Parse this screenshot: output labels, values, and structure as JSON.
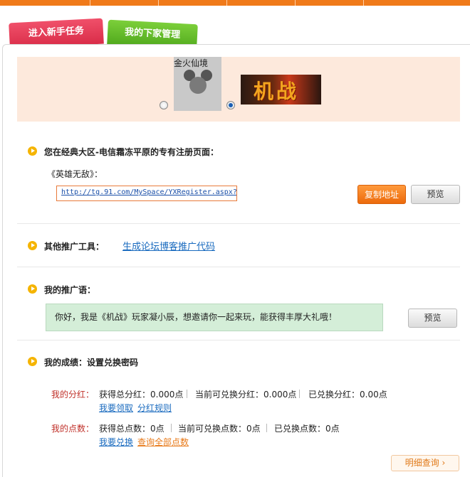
{
  "tabs": {
    "new_task": "进入新手任务",
    "my_downline": "我的下家管理"
  },
  "banner": {
    "logo_caption": "金火仙境",
    "game_logo_text": "机战"
  },
  "register": {
    "heading": "您在经典大区-电信霜冻平原的专有注册页面：",
    "game_name": "《英雄无敌》：",
    "url": "http://tg.91.com/MySpace/YXRegister.aspx?",
    "copy_button": "复制地址",
    "preview_button": "预览"
  },
  "tools": {
    "heading": "其他推广工具：",
    "link": "生成论坛博客推广代码"
  },
  "slogan": {
    "heading": "我的推广语：",
    "message": "你好，我是《机战》玩家凝小辰，想邀请你一起来玩，能获得丰厚大礼哦！",
    "preview_button": "预览"
  },
  "results": {
    "heading": "我的成绩：设置兑换密码",
    "dividend": {
      "label": "我的分红：",
      "total": "获得总分红：0.000点",
      "available": "当前可兑换分红：0.000点",
      "redeemed": "已兑换分红：0.00点",
      "link1": "我要领取",
      "link2": "分红规则"
    },
    "points": {
      "label": "我的点数：",
      "total": "获得总点数：0点",
      "available": "当前可兑换点数：0点",
      "redeemed": "已兑换点数：0点",
      "link1": "我要兑换",
      "link2": "查询全部点数"
    },
    "detail_button": "明细查询 ›"
  },
  "colors": {
    "accent": "#f07a1a",
    "banner_bg": "#fde9dc",
    "message_bg": "#d4eed8",
    "label_red": "#c0312a"
  }
}
